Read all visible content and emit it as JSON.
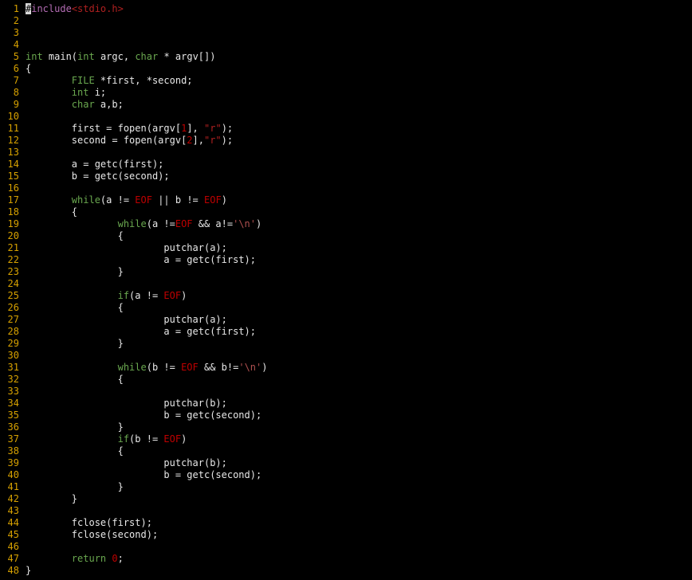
{
  "editor": {
    "cursor_char": "#",
    "lines": [
      {
        "n": "1",
        "tokens": [
          {
            "t": "#",
            "c": "cursor"
          },
          {
            "t": "include",
            "c": "pre"
          },
          {
            "t": "<stdio.h>",
            "c": "inc"
          }
        ]
      },
      {
        "n": "2",
        "tokens": []
      },
      {
        "n": "3",
        "tokens": []
      },
      {
        "n": "4",
        "tokens": []
      },
      {
        "n": "5",
        "tokens": [
          {
            "t": "int",
            "c": "type"
          },
          {
            "t": " main("
          },
          {
            "t": "int",
            "c": "type"
          },
          {
            "t": " argc, "
          },
          {
            "t": "char",
            "c": "type"
          },
          {
            "t": " * argv[])"
          }
        ]
      },
      {
        "n": "6",
        "tokens": [
          {
            "t": "{"
          }
        ]
      },
      {
        "n": "7",
        "tokens": [
          {
            "t": "        "
          },
          {
            "t": "FILE",
            "c": "type"
          },
          {
            "t": " *first, *second;"
          }
        ]
      },
      {
        "n": "8",
        "tokens": [
          {
            "t": "        "
          },
          {
            "t": "int",
            "c": "type"
          },
          {
            "t": " i;"
          }
        ]
      },
      {
        "n": "9",
        "tokens": [
          {
            "t": "        "
          },
          {
            "t": "char",
            "c": "type"
          },
          {
            "t": " a,b;"
          }
        ]
      },
      {
        "n": "10",
        "tokens": []
      },
      {
        "n": "11",
        "tokens": [
          {
            "t": "        first = fopen(argv["
          },
          {
            "t": "1",
            "c": "num"
          },
          {
            "t": "], "
          },
          {
            "t": "\"r\"",
            "c": "str"
          },
          {
            "t": ");"
          }
        ]
      },
      {
        "n": "12",
        "tokens": [
          {
            "t": "        second = fopen(argv["
          },
          {
            "t": "2",
            "c": "num"
          },
          {
            "t": "],"
          },
          {
            "t": "\"r\"",
            "c": "str"
          },
          {
            "t": ");"
          }
        ]
      },
      {
        "n": "13",
        "tokens": []
      },
      {
        "n": "14",
        "tokens": [
          {
            "t": "        a = getc(first);"
          }
        ]
      },
      {
        "n": "15",
        "tokens": [
          {
            "t": "        b = getc(second);"
          }
        ]
      },
      {
        "n": "16",
        "tokens": []
      },
      {
        "n": "17",
        "tokens": [
          {
            "t": "        "
          },
          {
            "t": "while",
            "c": "kw"
          },
          {
            "t": "(a != "
          },
          {
            "t": "EOF",
            "c": "eof"
          },
          {
            "t": " || b != "
          },
          {
            "t": "EOF",
            "c": "eof"
          },
          {
            "t": ")"
          }
        ]
      },
      {
        "n": "18",
        "tokens": [
          {
            "t": "        {"
          }
        ]
      },
      {
        "n": "19",
        "tokens": [
          {
            "t": "                "
          },
          {
            "t": "while",
            "c": "kw"
          },
          {
            "t": "(a !="
          },
          {
            "t": "EOF",
            "c": "eof"
          },
          {
            "t": " && a!="
          },
          {
            "t": "'\\n'",
            "c": "chr"
          },
          {
            "t": ")"
          }
        ]
      },
      {
        "n": "20",
        "tokens": [
          {
            "t": "                {"
          }
        ]
      },
      {
        "n": "21",
        "tokens": [
          {
            "t": "                        putchar(a);"
          }
        ]
      },
      {
        "n": "22",
        "tokens": [
          {
            "t": "                        a = getc(first);"
          }
        ]
      },
      {
        "n": "23",
        "tokens": [
          {
            "t": "                }"
          }
        ]
      },
      {
        "n": "24",
        "tokens": []
      },
      {
        "n": "25",
        "tokens": [
          {
            "t": "                "
          },
          {
            "t": "if",
            "c": "kw"
          },
          {
            "t": "(a != "
          },
          {
            "t": "EOF",
            "c": "eof"
          },
          {
            "t": ")"
          }
        ]
      },
      {
        "n": "26",
        "tokens": [
          {
            "t": "                {"
          }
        ]
      },
      {
        "n": "27",
        "tokens": [
          {
            "t": "                        putchar(a);"
          }
        ]
      },
      {
        "n": "28",
        "tokens": [
          {
            "t": "                        a = getc(first);"
          }
        ]
      },
      {
        "n": "29",
        "tokens": [
          {
            "t": "                }"
          }
        ]
      },
      {
        "n": "30",
        "tokens": []
      },
      {
        "n": "31",
        "tokens": [
          {
            "t": "                "
          },
          {
            "t": "while",
            "c": "kw"
          },
          {
            "t": "(b != "
          },
          {
            "t": "EOF",
            "c": "eof"
          },
          {
            "t": " && b!="
          },
          {
            "t": "'\\n'",
            "c": "chr"
          },
          {
            "t": ")"
          }
        ]
      },
      {
        "n": "32",
        "tokens": [
          {
            "t": "                {"
          }
        ]
      },
      {
        "n": "33",
        "tokens": []
      },
      {
        "n": "34",
        "tokens": [
          {
            "t": "                        putchar(b);"
          }
        ]
      },
      {
        "n": "35",
        "tokens": [
          {
            "t": "                        b = getc(second);"
          }
        ]
      },
      {
        "n": "36",
        "tokens": [
          {
            "t": "                }"
          }
        ]
      },
      {
        "n": "37",
        "tokens": [
          {
            "t": "                "
          },
          {
            "t": "if",
            "c": "kw"
          },
          {
            "t": "(b != "
          },
          {
            "t": "EOF",
            "c": "eof"
          },
          {
            "t": ")"
          }
        ]
      },
      {
        "n": "38",
        "tokens": [
          {
            "t": "                {"
          }
        ]
      },
      {
        "n": "39",
        "tokens": [
          {
            "t": "                        putchar(b);"
          }
        ]
      },
      {
        "n": "40",
        "tokens": [
          {
            "t": "                        b = getc(second);"
          }
        ]
      },
      {
        "n": "41",
        "tokens": [
          {
            "t": "                }"
          }
        ]
      },
      {
        "n": "42",
        "tokens": [
          {
            "t": "        }"
          }
        ]
      },
      {
        "n": "43",
        "tokens": []
      },
      {
        "n": "44",
        "tokens": [
          {
            "t": "        fclose(first);"
          }
        ]
      },
      {
        "n": "45",
        "tokens": [
          {
            "t": "        fclose(second);"
          }
        ]
      },
      {
        "n": "46",
        "tokens": []
      },
      {
        "n": "47",
        "tokens": [
          {
            "t": "        "
          },
          {
            "t": "return",
            "c": "kw"
          },
          {
            "t": " "
          },
          {
            "t": "0",
            "c": "num"
          },
          {
            "t": ";"
          }
        ]
      },
      {
        "n": "48",
        "tokens": [
          {
            "t": "}"
          }
        ]
      }
    ]
  },
  "colors": {
    "background": "#000000",
    "text": "#e8e8e8",
    "line_number": "#d6a000",
    "keyword": "#6aa84f",
    "preprocessor": "#b36bb3",
    "string": "#b02020",
    "number": "#c00000"
  }
}
